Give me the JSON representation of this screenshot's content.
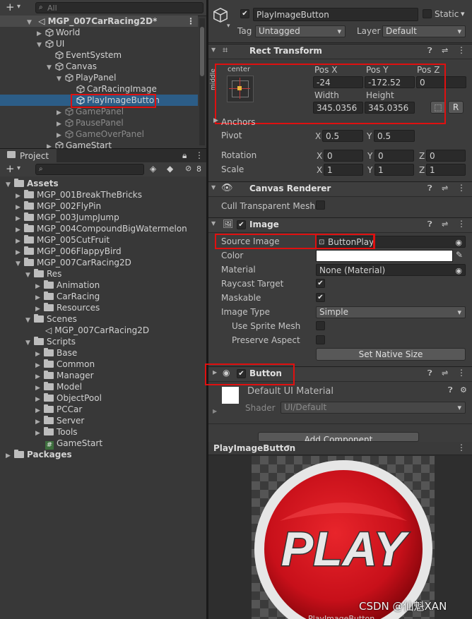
{
  "hierarchy": {
    "search_placeholder": "All",
    "scene_name": "MGP_007CarRacing2D*",
    "items": [
      "World",
      "UI",
      "EventSystem",
      "Canvas",
      "PlayPanel",
      "CarRacingImage",
      "PlayImageButton",
      "GamePanel",
      "PausePanel",
      "GameOverPanel",
      "GameStart"
    ]
  },
  "project": {
    "tab_label": "Project",
    "hidden_count": "8",
    "assets_label": "Assets",
    "folders": [
      "MGP_001BreakTheBricks",
      "MGP_002FlyPin",
      "MGP_003JumpJump",
      "MGP_004CompoundBigWatermelon",
      "MGP_005CutFruit",
      "MGP_006FlappyBird",
      "MGP_007CarRacing2D"
    ],
    "res_label": "Res",
    "res_children": [
      "Animation",
      "CarRacing",
      "Resources"
    ],
    "scenes_label": "Scenes",
    "scene_file": "MGP_007CarRacing2D",
    "scripts_label": "Scripts",
    "script_folders": [
      "Base",
      "Common",
      "Manager",
      "Model",
      "ObjectPool",
      "PCCar",
      "Server",
      "Tools"
    ],
    "gamestart_script": "GameStart",
    "packages_label": "Packages"
  },
  "inspector": {
    "object_name": "PlayImageButton",
    "static_label": "Static",
    "tag_label": "Tag",
    "tag_value": "Untagged",
    "layer_label": "Layer",
    "layer_value": "Default",
    "rect_transform": {
      "title": "Rect Transform",
      "anchor_h": "center",
      "anchor_v": "middle",
      "pos_x_label": "Pos X",
      "pos_x": "-24",
      "pos_y_label": "Pos Y",
      "pos_y": "-172.52",
      "pos_z_label": "Pos Z",
      "pos_z": "0",
      "width_label": "Width",
      "width": "345.0356",
      "height_label": "Height",
      "height": "345.0356",
      "r_button": "R",
      "anchors_label": "Anchors",
      "pivot_label": "Pivot",
      "pivot_x": "0.5",
      "pivot_y": "0.5",
      "rotation_label": "Rotation",
      "rot_x": "0",
      "rot_y": "0",
      "rot_z": "0",
      "scale_label": "Scale",
      "scale_x": "1",
      "scale_y": "1",
      "scale_z": "1",
      "x": "X",
      "y": "Y",
      "z": "Z"
    },
    "canvas_renderer": {
      "title": "Canvas Renderer",
      "cull_label": "Cull Transparent Mesh"
    },
    "image": {
      "title": "Image",
      "source_label": "Source Image",
      "source_value": "ButtonPlay",
      "color_label": "Color",
      "material_label": "Material",
      "material_value": "None (Material)",
      "raycast_label": "Raycast Target",
      "maskable_label": "Maskable",
      "image_type_label": "Image Type",
      "image_type_value": "Simple",
      "use_sprite_mesh_label": "Use Sprite Mesh",
      "preserve_aspect_label": "Preserve Aspect",
      "set_native_label": "Set Native Size"
    },
    "button": {
      "title": "Button"
    },
    "material": {
      "name": "Default UI Material",
      "shader_label": "Shader",
      "shader_value": "UI/Default"
    },
    "add_component": "Add Component",
    "preview_title": "PlayImageButton",
    "preview_bottom": "PlayImageButton",
    "play_text": "PLAY"
  },
  "watermark": "CSDN @仙魁XAN",
  "colors": {
    "selection": "#2c5d87",
    "highlight": "#e01010",
    "play_red": "#c8101a"
  }
}
